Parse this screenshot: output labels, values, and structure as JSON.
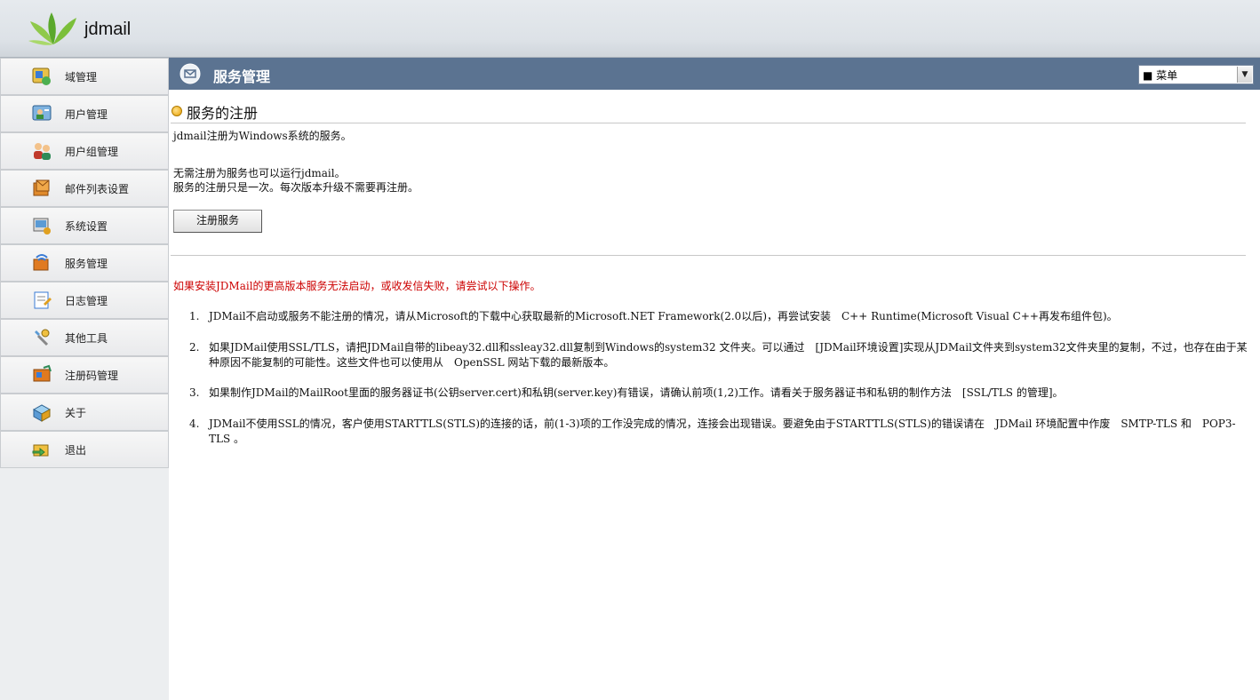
{
  "app": {
    "logo_text": "jdmail"
  },
  "sidebar": {
    "items": [
      {
        "label": "域管理",
        "icon": "domain-icon"
      },
      {
        "label": "用户管理",
        "icon": "user-icon"
      },
      {
        "label": "用户组管理",
        "icon": "user-group-icon"
      },
      {
        "label": "邮件列表设置",
        "icon": "mailing-list-icon"
      },
      {
        "label": "系统设置",
        "icon": "system-settings-icon"
      },
      {
        "label": "服务管理",
        "icon": "service-icon"
      },
      {
        "label": "日志管理",
        "icon": "log-icon"
      },
      {
        "label": "其他工具",
        "icon": "tools-icon"
      },
      {
        "label": "注册码管理",
        "icon": "license-icon"
      },
      {
        "label": "关于",
        "icon": "about-icon"
      },
      {
        "label": "退出",
        "icon": "logout-icon"
      }
    ]
  },
  "header": {
    "title": "服务管理",
    "menu_value": "■ 菜单"
  },
  "section": {
    "title": "服务的注册",
    "line1": "jdmail注册为Windows系统的服务。",
    "line2": "无需注册为服务也可以运行jdmail。",
    "line3": "服务的注册只是一次。每次版本升级不需要再注册。",
    "button": "注册服务"
  },
  "warning": "如果安装JDMail的更高版本服务无法启动，或收发信失败，请尝试以下操作。",
  "list": [
    {
      "num": "1.",
      "text": "JDMail不启动或服务不能注册的情况，请从Microsoft的下载中心获取最新的Microsoft.NET Framework(2.0以后)，再尝试安装　C++ Runtime(Microsoft Visual C++再发布组件包)。"
    },
    {
      "num": "2.",
      "text": "如果JDMail使用SSL/TLS，请把JDMail自带的libeay32.dll和ssleay32.dll复制到Windows的system32 文件夹。可以通过　[JDMail环境设置]实现从JDMail文件夹到system32文件夹里的复制，不过，也存在由于某种原因不能复制的可能性。这些文件也可以使用从　OpenSSL 网站下载的最新版本。"
    },
    {
      "num": "3.",
      "text": "如果制作JDMail的MailRoot里面的服务器证书(公钥server.cert)和私钥(server.key)有错误，请确认前项(1,2)工作。请看关于服务器证书和私钥的制作方法　[SSL/TLS 的管理]。"
    },
    {
      "num": "4.",
      "text": "JDMail不使用SSL的情况，客户使用STARTTLS(STLS)的连接的话，前(1-3)项的工作没完成的情况，连接会出现错误。要避免由于STARTTLS(STLS)的错误请在　JDMail 环境配置中作废　SMTP-TLS 和　POP3-TLS 。"
    }
  ]
}
